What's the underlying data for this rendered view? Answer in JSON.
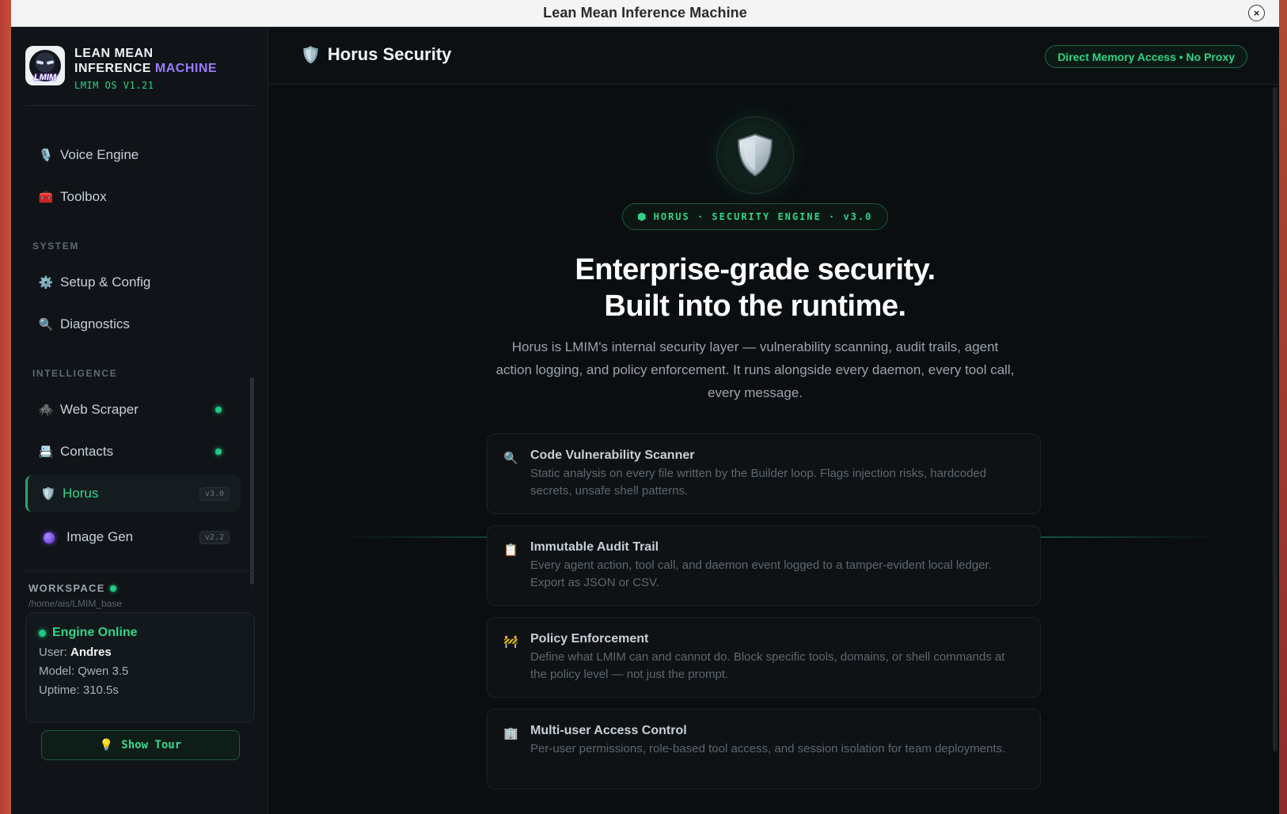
{
  "window": {
    "title": "Lean Mean Inference Machine",
    "close_glyph": "×"
  },
  "brand": {
    "logo_text": "LMIM",
    "line1": "LEAN MEAN",
    "line2_main": "INFERENCE",
    "line2_accent": "MACHINE",
    "version": "LMIM OS V1.21",
    "accent_color": "#9b7bff"
  },
  "sidebar": {
    "items_top": [
      {
        "label": "Voice Engine",
        "icon": "🎙️",
        "icon_name": "microphone-icon"
      },
      {
        "label": "Toolbox",
        "icon": "🧰",
        "icon_name": "toolbox-icon"
      }
    ],
    "system_label": "SYSTEM",
    "system_items": [
      {
        "label": "Setup & Config",
        "icon": "⚙️",
        "icon_name": "gear-icon"
      },
      {
        "label": "Diagnostics",
        "icon": "🔍",
        "icon_name": "magnifier-icon"
      }
    ],
    "intelligence_label": "INTELLIGENCE",
    "intelligence_items": [
      {
        "label": "Web Scraper",
        "icon": "🕷️",
        "icon_name": "spider-icon",
        "status": "online"
      },
      {
        "label": "Contacts",
        "icon": "📇",
        "icon_name": "contacts-icon",
        "status": "online"
      },
      {
        "label": "Horus",
        "icon": "🛡️",
        "icon_name": "shield-icon",
        "tag": "v3.0",
        "active": true
      },
      {
        "label": "Image Gen",
        "icon": "🟣",
        "icon_name": "purple-orb-icon",
        "tag": "v2.2"
      }
    ]
  },
  "workspace": {
    "label": "WORKSPACE",
    "path": "/home/ais/LMIM_base",
    "status": "Engine Online",
    "user_label": "User:",
    "user": "Andres",
    "model": "Model: Qwen 3.5",
    "uptime": "Uptime: 310.5s",
    "tour_icon": "💡",
    "tour_label": "Show Tour"
  },
  "header": {
    "title": "Horus Security",
    "title_icon": "🛡️",
    "badge": "Direct Memory Access • No Proxy"
  },
  "hero": {
    "pill": "HORUS · SECURITY ENGINE · v3.0",
    "headline_1": "Enterprise-grade security.",
    "headline_2": "Built into the runtime.",
    "lede": "Horus is LMIM's internal security layer — vulnerability scanning, audit trails, agent action logging, and policy enforcement. It runs alongside every daemon, every tool call, every message."
  },
  "features": [
    {
      "icon": "🔍",
      "icon_name": "magnifier-icon",
      "title": "Code Vulnerability Scanner",
      "desc": "Static analysis on every file written by the Builder loop. Flags injection risks, hardcoded secrets, unsafe shell patterns."
    },
    {
      "icon": "📋",
      "icon_name": "clipboard-icon",
      "title": "Immutable Audit Trail",
      "desc": "Every agent action, tool call, and daemon event logged to a tamper-evident local ledger. Export as JSON or CSV."
    },
    {
      "icon": "🚧",
      "icon_name": "barrier-icon",
      "title": "Policy Enforcement",
      "desc": "Define what LMIM can and cannot do. Block specific tools, domains, or shell commands at the policy level — not just the prompt."
    },
    {
      "icon": "🏢",
      "icon_name": "building-icon",
      "title": "Multi-user Access Control",
      "desc": "Per-user permissions, role-based tool access, and session isolation for team deployments."
    }
  ],
  "colors": {
    "accent_green": "#2fd486",
    "background": "#0b0e11"
  }
}
